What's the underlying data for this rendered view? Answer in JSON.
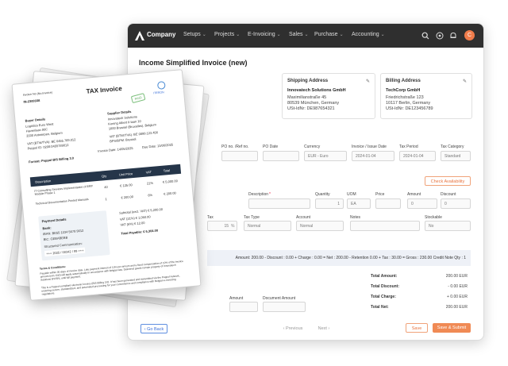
{
  "app": {
    "brand": "Company",
    "nav": [
      "Setups",
      "Projects",
      "E-Invoicing",
      "Sales",
      "Purchase",
      "Accounting"
    ],
    "avatar_initial": "C",
    "icons": [
      "search-icon",
      "whatsapp-icon",
      "bell-icon"
    ]
  },
  "page": {
    "title": "Income Simplified Invoice (new)"
  },
  "addresses": {
    "shipping": {
      "title": "Shipping Address",
      "name": "Innovatech Solutions GmbH",
      "line1": "Maximilianstraße 45",
      "line2": "80539 München, Germany",
      "line3": "USt-IdNr: DE987654321"
    },
    "billing": {
      "title": "Billing Address",
      "name": "TechCorp GmbH",
      "line1": "Friedrichstraße 123",
      "line2": "10117 Berlin, Germany",
      "line3": "USt-IdNr: DE123456789"
    }
  },
  "header_fields": {
    "labels": [
      "PO no. /Ref no.",
      "PO Date",
      "Currency",
      "Invoice / Issue Date",
      "Tax Period",
      "Tax Category"
    ],
    "values": [
      "",
      "",
      "EUR - Euro",
      "2024-01-04",
      "2024-01-04",
      "Standard"
    ]
  },
  "check_availability": "Check Availability",
  "line_fields": {
    "labels": [
      "Description",
      "Quantity",
      "UOM",
      "Price",
      "Amount",
      "Discount"
    ],
    "values": [
      "",
      "1",
      "EA",
      "",
      "0",
      "0"
    ]
  },
  "tax_fields": {
    "labels": [
      "Tax",
      "Tax Type",
      "Account",
      "Notes",
      "Stockable"
    ],
    "values": [
      "15",
      "Normal",
      "Normal",
      "",
      "No"
    ]
  },
  "summary_line": "Amount: 200.00 - Discount : 0.00 + Charge : 0.00 = Net : 200.00 - Retention 0.00 + Tax : 30.00 = Gross : 230.00 Credit Note Qty : 1",
  "lower_labels": {
    "amount": "Amount",
    "document_amount": "Document Amount"
  },
  "totals": [
    {
      "label": "Total Amount:",
      "value": "200.00 EUR"
    },
    {
      "label": "Total Discount:",
      "value": "- 0.00 EUR"
    },
    {
      "label": "Total Charge:",
      "value": "+ 0.00 EUR"
    },
    {
      "label": "Total Net:",
      "value": "200.00 EUR"
    }
  ],
  "footer": {
    "back": "Go Back",
    "previous": "Previous",
    "next": "Next",
    "save": "Save",
    "save_submit": "Save & Submit"
  },
  "invoice_doc": {
    "title": "TAX Invoice",
    "stamp": "PAID",
    "logo_text": "ITERON",
    "invoice_no_label": "Invoice No (No.Invoice)",
    "invoice_no": "IN-2300338",
    "buyer_title": "Buyer Details",
    "buyer_name": "Logistics Euro West",
    "buyer_l1": "Havenlaan 86C",
    "buyer_l2": "2030 Antwerpen, Belgium",
    "buyer_vat": "VAT (BTW/TVA): BE 0455.789.012",
    "buyer_peppol": "Peppol ID: 0208:0455789012",
    "supplier_title": "Supplier Details",
    "supplier_name": "Innovatech Solutions",
    "supplier_l1": "Koning Albert II-laan 10",
    "supplier_l2": "1000 Brussel (Bruxelles), Belgium",
    "supplier_vat": "VAT (BTW/TVA): BE 0899.123.456",
    "supplier_peppol": "BPS/BPM: Brussel",
    "format": "Format: Peppol BIS Billing 3.0",
    "invoice_date": "Invoice Date: 14/05/2025",
    "due_date": "Due Date: 13/06/2025",
    "columns": [
      "Description",
      "Qty",
      "Unit Price",
      "VAT",
      "Total"
    ],
    "rows": [
      {
        "desc": "IT Consulting Services Implementation of ERP Module Phase 1",
        "qty": "40",
        "unit": "€ 125.00",
        "vat": "21%",
        "total": "€ 5,000.00"
      },
      {
        "desc": "Technical Documentation Printed Manuals",
        "qty": "1",
        "unit": "€ 200.00",
        "vat": "6%",
        "total": "€ 200.00"
      }
    ],
    "pay_title": "Payment Details",
    "bank_label": "Bank:",
    "iban": "IBAN: BE55 1234 5678 9012",
    "bic": "BIC: GEBABEBB",
    "structured": "Structured Communication:",
    "structured_val": "+++ 2025 / 00342 / 99 +++",
    "subtotal": "Subtotal (excl. VAT)    € 5,200.00",
    "vat21": "VAT (21%)    € 1,050.00",
    "vat6": "VAT (6%)    € 12.00",
    "total_payable": "Total Payable:    € 6,304.00",
    "terms_title": "Terms & Conditions:",
    "terms": "Payable within 30 days of invoice date. Late payment interest of 10% per annum and a fixed compensation of 10% of the invoice amount (min. €40) will apply automatically in accordance with Belgian law. Delivered goods remain property of Innovatech Solutions BV/SRL until full payment.",
    "peppol_note": "This is a Peppol-compliant electronic invoice (BIS Billing 3.0). It has been generated and transmitted via the Peppol network, ensuring secure, standardized, and automated processing for your convenience and compliance with Belgian e-invoicing regulations."
  },
  "colors": {
    "nav_bg": "#2f2f2f",
    "accent": "#ef7b4a",
    "table_header": "#253549",
    "primary": "#3a6fd8"
  }
}
